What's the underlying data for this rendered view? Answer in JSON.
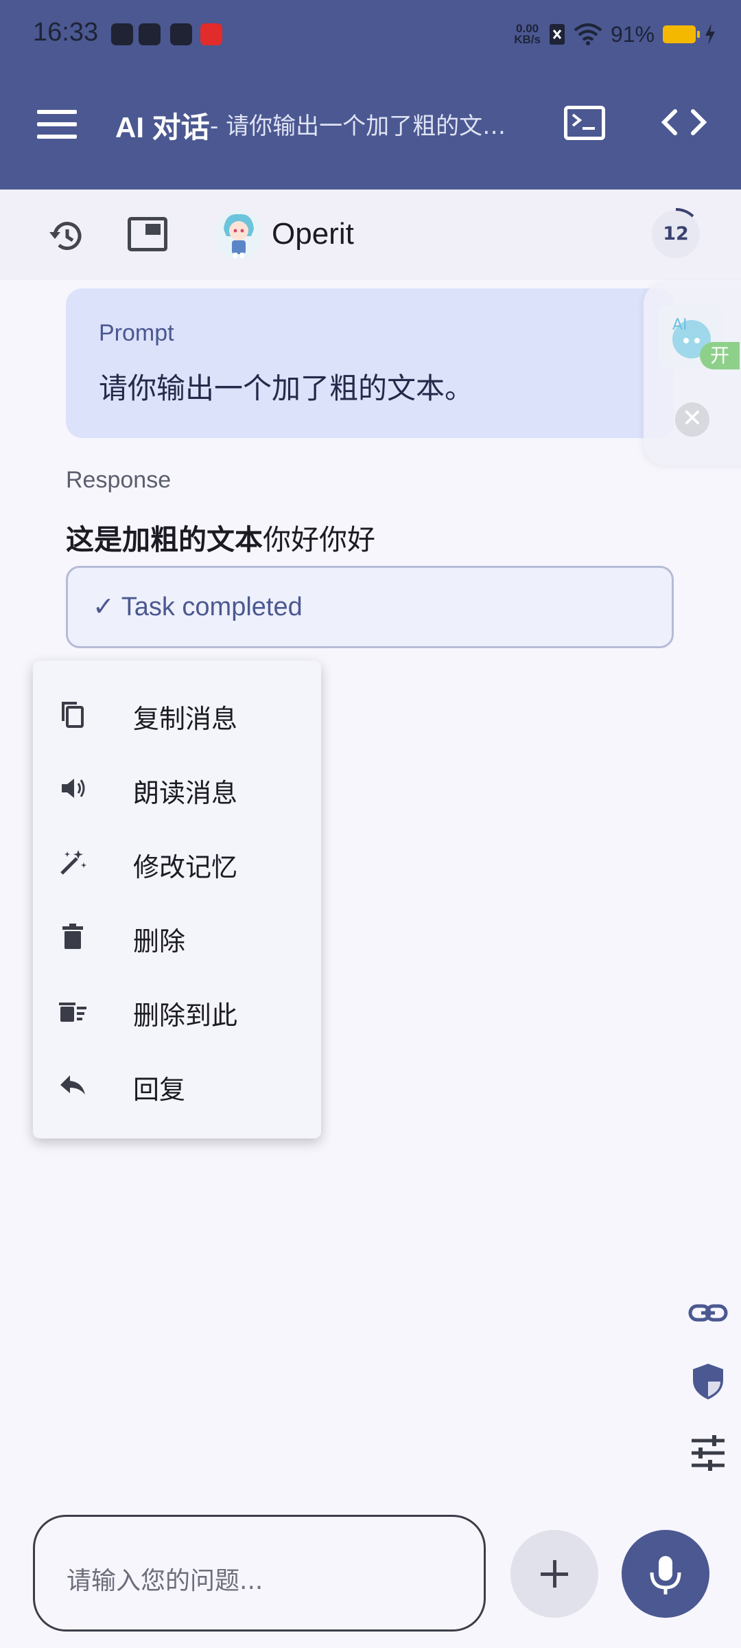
{
  "status_bar": {
    "time": "16:33",
    "net_speed_value": "0.00",
    "net_speed_unit": "KB/s",
    "battery_percent": "91%",
    "battery_color": "#f5b800"
  },
  "app_bar": {
    "app_title": "AI 对话",
    "chat_title": "- 请你输出一个加了粗的文本。",
    "bg_color": "#4b5891"
  },
  "toolbar": {
    "character_name": "Operit",
    "counter": "12"
  },
  "conversation": {
    "prompt_label": "Prompt",
    "prompt_text": "请你输出一个加了粗的文本。",
    "response_label": "Response",
    "response_bold": "这是加粗的文本",
    "response_normal": "你好你好",
    "task_status": "✓ Task completed"
  },
  "floating_assistant": {
    "badge": "开",
    "close": "✕"
  },
  "context_menu": {
    "items": [
      {
        "label": "复制消息",
        "icon": "copy-icon"
      },
      {
        "label": "朗读消息",
        "icon": "speaker-icon"
      },
      {
        "label": "修改记忆",
        "icon": "magic-wand-icon"
      },
      {
        "label": "删除",
        "icon": "trash-icon"
      },
      {
        "label": "删除到此",
        "icon": "delete-sweep-icon"
      },
      {
        "label": "回复",
        "icon": "reply-icon"
      }
    ]
  },
  "side_actions": [
    "link-icon",
    "shield-icon",
    "tune-icon"
  ],
  "input": {
    "placeholder": "请输入您的问题..."
  }
}
